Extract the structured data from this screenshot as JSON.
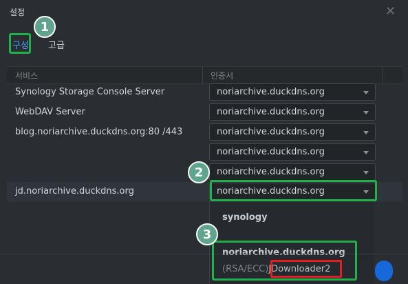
{
  "window": {
    "title": "설정",
    "close_icon": "close-icon"
  },
  "tabs": [
    {
      "label": "구성"
    },
    {
      "label": "고급"
    }
  ],
  "table": {
    "headers": {
      "service": "서비스",
      "certificate": "인증서"
    },
    "rows": [
      {
        "service": "Synology Storage Console Server",
        "certificate": "noriarchive.duckdns.org"
      },
      {
        "service": "WebDAV Server",
        "certificate": "noriarchive.duckdns.org"
      },
      {
        "service": "blog.noriarchive.duckdns.org:80 /443",
        "certificate": "noriarchive.duckdns.org"
      },
      {
        "service": "",
        "certificate": "noriarchive.duckdns.org"
      },
      {
        "service": "",
        "certificate": "noriarchive.duckdns.org"
      },
      {
        "service": "jd.noriarchive.duckdns.org",
        "certificate": "noriarchive.duckdns.org"
      }
    ]
  },
  "dropdown": {
    "options": [
      {
        "label": "synology"
      },
      {
        "label": "noriarchive.duckdns.org",
        "sub_prefix": "(RSA/ECC)",
        "sub_highlight": "JDownloader2"
      }
    ]
  },
  "annotations": {
    "step1": "1",
    "step2": "2",
    "step3": "3"
  },
  "colors": {
    "accent": "#4aa3ff",
    "annotation_green": "#22b04b",
    "annotation_red": "#e02020",
    "step_circle": "#5fa58e",
    "primary_button": "#1768d8"
  }
}
